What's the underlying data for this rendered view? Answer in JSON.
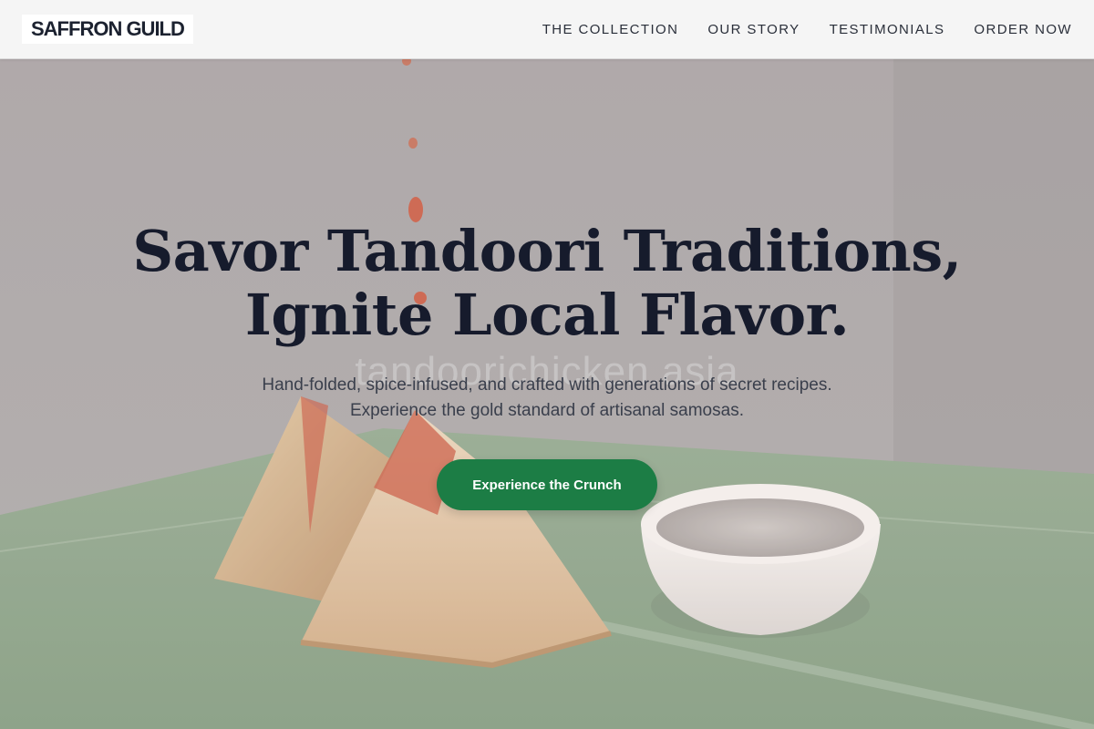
{
  "header": {
    "logo": "SAFFRON GUILD",
    "nav": [
      {
        "label": "THE COLLECTION"
      },
      {
        "label": "OUR STORY"
      },
      {
        "label": "TESTIMONIALS"
      },
      {
        "label": "ORDER NOW"
      }
    ]
  },
  "hero": {
    "title_line1": "Savor Tandoori Traditions,",
    "title_line2": "Ignite Local Flavor.",
    "subtitle_line1": "Hand-folded, spice-infused, and crafted with generations of secret recipes.",
    "subtitle_line2": "Experience the gold standard of artisanal samosas.",
    "cta_label": "Experience the Crunch",
    "watermark": "tandoorichicken.asia"
  },
  "colors": {
    "cta": "#1c7d45",
    "heading": "#161b2c",
    "header_bg": "#f5f5f5"
  }
}
